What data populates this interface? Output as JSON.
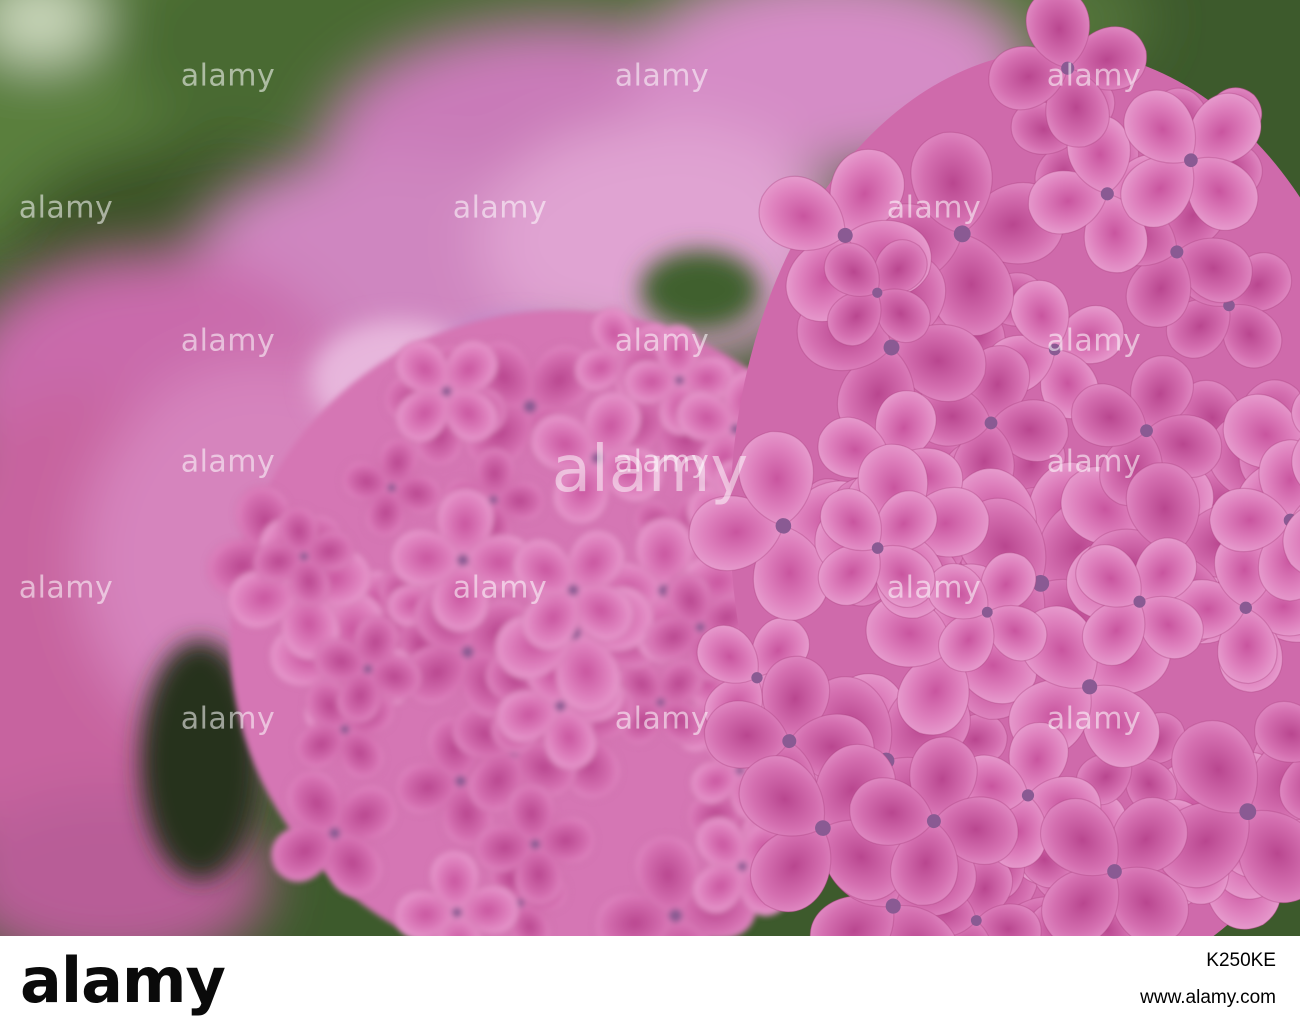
{
  "photo": {
    "subject": "pink hydrangea blossoms",
    "colors": {
      "petal": "#d873b4",
      "petal_dark": "#b84b93",
      "petal_light": "#eaa3d3",
      "foliage": "#4b6e35"
    }
  },
  "watermark": {
    "text": "alamy"
  },
  "footer": {
    "brand": "alamy",
    "stock_id": "K250KE",
    "site": "www.alamy.com"
  }
}
